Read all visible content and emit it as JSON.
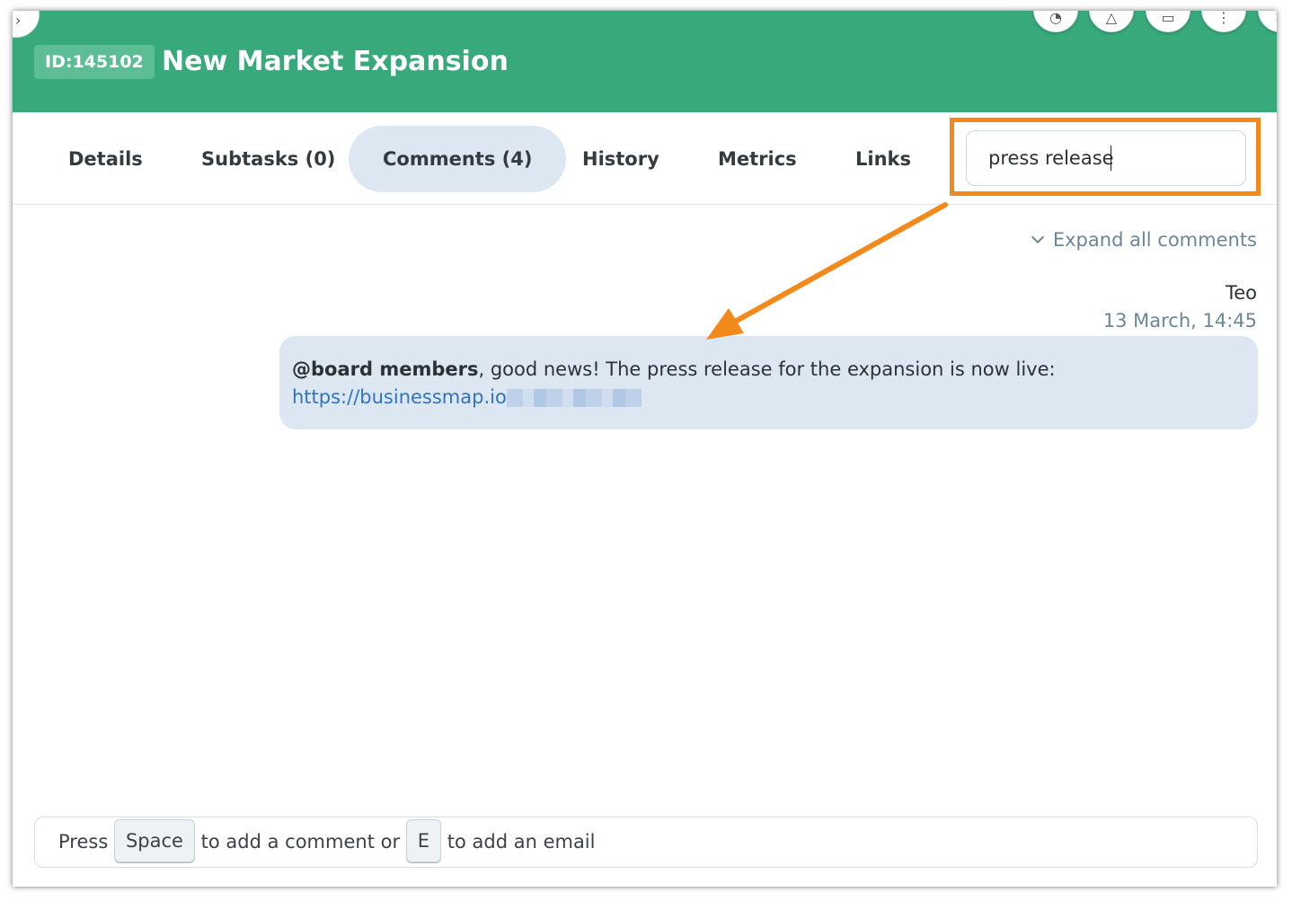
{
  "header": {
    "card_id": "ID:145102",
    "card_title": "New Market Expansion",
    "action_icons": [
      "palette-icon",
      "alert-icon",
      "layout-icon",
      "more-icon",
      "close-icon"
    ]
  },
  "tabs": [
    {
      "label": "Details",
      "active": false
    },
    {
      "label": "Subtasks (0)",
      "active": false
    },
    {
      "label": "Comments (4)",
      "active": true
    },
    {
      "label": "History",
      "active": false
    },
    {
      "label": "Metrics",
      "active": false
    },
    {
      "label": "Links",
      "active": false
    }
  ],
  "search": {
    "value": "press release",
    "highlight_color": "#f28a1b"
  },
  "comments": {
    "expand_label": "Expand all comments",
    "items": [
      {
        "author": "Teo",
        "timestamp": "13 March, 14:45",
        "mention": "@board members",
        "text": ", good news! The press release for the expansion is now live:",
        "link": "https://businessmap.io"
      }
    ]
  },
  "composer": {
    "prefix": "Press",
    "key_comment": "Space",
    "middle": "to add a comment or",
    "key_email": "E",
    "suffix": "to add an email"
  },
  "colors": {
    "header_bg": "#37a97b",
    "active_tab_bg": "#dde7f2",
    "comment_bg": "#dde7f2",
    "link": "#2f74c0"
  }
}
